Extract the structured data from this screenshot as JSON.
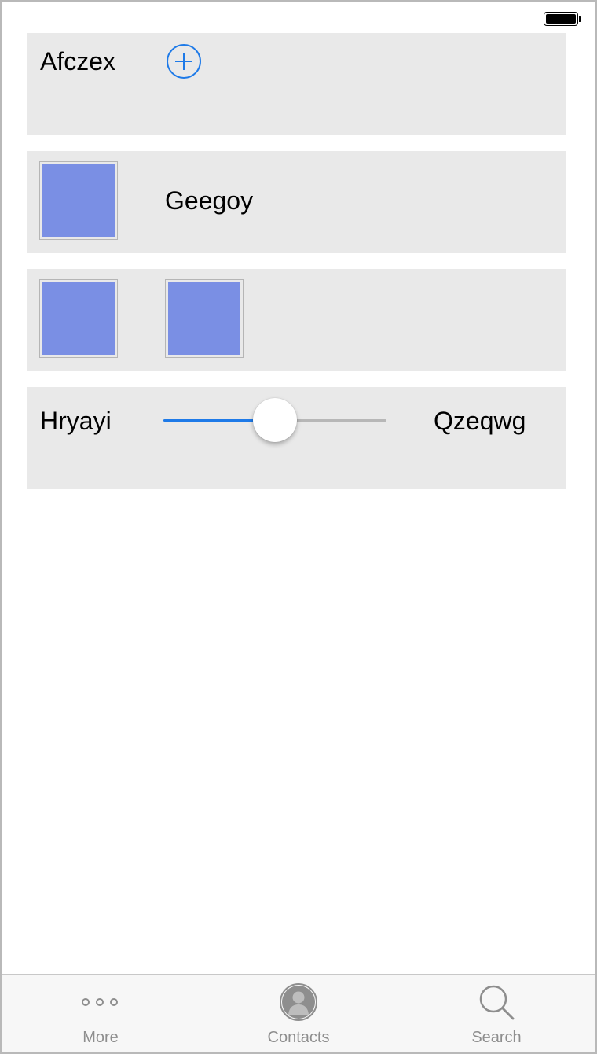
{
  "status_bar": {
    "battery_level": 1.0
  },
  "rows": [
    {
      "label": "Afczex",
      "action_icon": "plus-circle-icon"
    },
    {
      "thumbnail_icon": "image-placeholder-icon",
      "label": "Geegoy"
    },
    {
      "thumbnails": [
        "image-placeholder-icon",
        "image-placeholder-icon"
      ]
    },
    {
      "min_label": "Hryayi",
      "max_label": "Qzeqwg",
      "slider_value": 0.5
    }
  ],
  "tab_bar": {
    "tabs": [
      {
        "label": "More",
        "icon": "more-dots-icon"
      },
      {
        "label": "Contacts",
        "icon": "contact-avatar-icon"
      },
      {
        "label": "Search",
        "icon": "search-icon"
      }
    ]
  },
  "colors": {
    "accent": "#1e7ae8",
    "thumbnail_fill": "#7a8fe4",
    "card_background": "#e9e9e9",
    "tab_inactive": "#8e8e8e"
  }
}
